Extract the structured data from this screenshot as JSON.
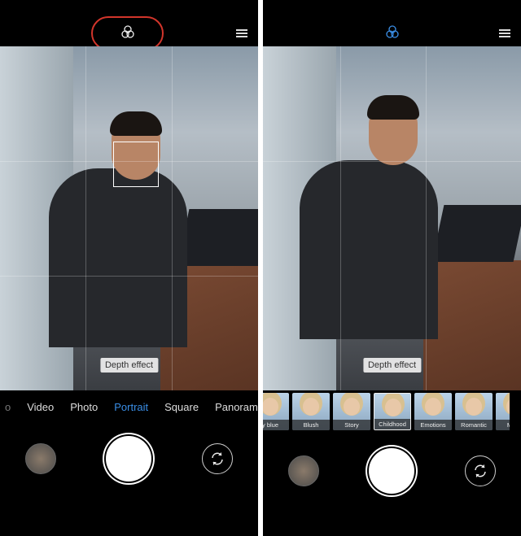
{
  "left": {
    "modes": [
      "o",
      "Video",
      "Photo",
      "Portrait",
      "Square",
      "Panoram"
    ],
    "active_mode": "Portrait",
    "depth_label": "Depth effect"
  },
  "right": {
    "depth_label": "Depth effect",
    "filters": [
      "y blue",
      "Blush",
      "Story",
      "Childhood",
      "Emotions",
      "Romantic",
      "Maze"
    ],
    "selected_filter": "Childhood"
  },
  "colors": {
    "accent": "#3a8ee6",
    "highlight": "#d2352b"
  },
  "icons": {
    "filters": "three-circles-icon",
    "menu": "hamburger-icon",
    "switch": "camera-flip-icon"
  }
}
